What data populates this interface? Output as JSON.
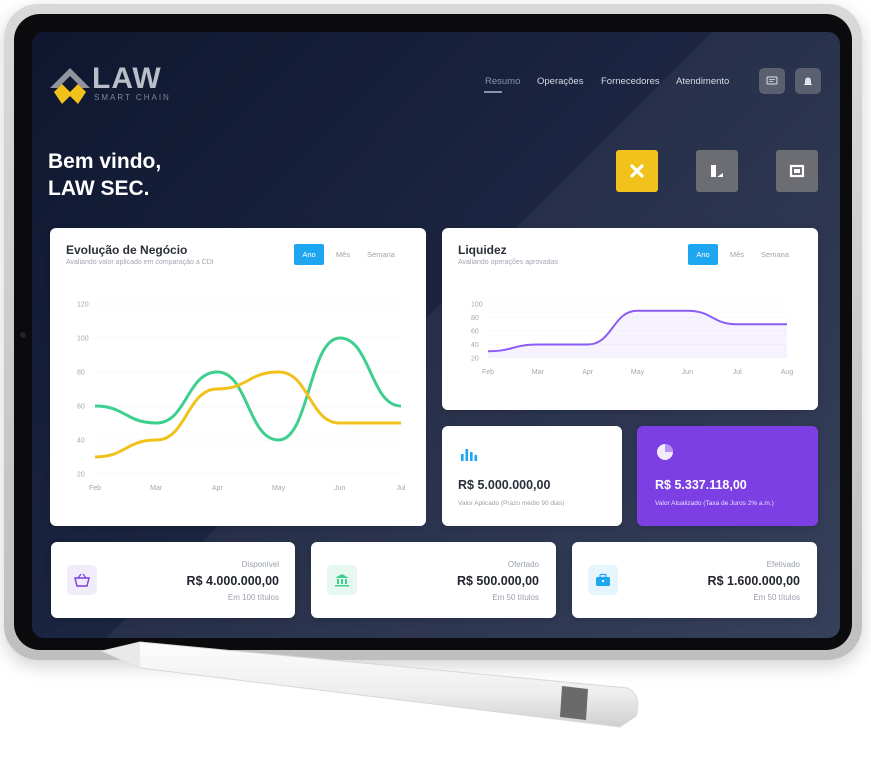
{
  "brand": {
    "name": "LAW",
    "tagline": "SMART CHAIN"
  },
  "nav": {
    "items": [
      {
        "label": "Resumo",
        "active": true
      },
      {
        "label": "Operações",
        "active": false
      },
      {
        "label": "Fornecedores",
        "active": false
      },
      {
        "label": "Atendimento",
        "active": false
      }
    ],
    "icons": [
      "chat-icon",
      "bell-icon"
    ]
  },
  "welcome": {
    "line1": "Bem vindo,",
    "line2": "LAW SEC."
  },
  "quick_actions": [
    {
      "icon": "close-x-icon",
      "color": "#f1c21b"
    },
    {
      "icon": "document-icon",
      "color": "#6b6d72"
    },
    {
      "icon": "building-icon",
      "color": "#6b6d72"
    }
  ],
  "evolucao": {
    "title": "Evolução de Negócio",
    "subtitle": "Avaliando valor aplicado em comparação a CDI",
    "tabs": [
      "Ano",
      "Mês",
      "Semana"
    ],
    "active_tab": "Ano"
  },
  "liquidez": {
    "title": "Liquidez",
    "subtitle": "Avaliando operações aprovadas",
    "tabs": [
      "Ano",
      "Mês",
      "Semana"
    ],
    "active_tab": "Ano"
  },
  "aplicado": {
    "value": "R$ 5.000.000,00",
    "note": "Valor Aplicado (Prazo médio 90 dias)",
    "icon": "bar-chart-icon"
  },
  "atualizado": {
    "value": "R$ 5.337.118,00",
    "note": "Valor Atualizado (Taxa de Juros 2% a.m.)",
    "icon": "pie-chart-icon",
    "color": "#7b3fe4"
  },
  "stats": [
    {
      "label": "Disponível",
      "value": "R$ 4.000.000,00",
      "sub": "Em 100 títulos",
      "icon": "basket-icon",
      "icon_color": "#7b3fe4",
      "icon_bg": "#f1ecfb"
    },
    {
      "label": "Ofertado",
      "value": "R$ 500.000,00",
      "sub": "Em 50 títulos",
      "icon": "bank-icon",
      "icon_color": "#3ecf8e",
      "icon_bg": "#e6f8ef"
    },
    {
      "label": "Efetivado",
      "value": "R$ 1.600.000,00",
      "sub": "Em 50 títulos",
      "icon": "briefcase-icon",
      "icon_color": "#1ea7f0",
      "icon_bg": "#e5f4fd"
    }
  ],
  "chart_data": [
    {
      "type": "line",
      "categories": [
        "Feb",
        "Mar",
        "Apr",
        "May",
        "Jun",
        "Jul"
      ],
      "ylim": [
        20,
        120
      ],
      "yticks": [
        20,
        40,
        60,
        80,
        100,
        120
      ],
      "series": [
        {
          "values": [
            60,
            50,
            80,
            40,
            100,
            60
          ],
          "color": "#3ecf8e"
        },
        {
          "values": [
            30,
            40,
            70,
            80,
            50,
            50
          ],
          "color": "#f1c21b"
        }
      ]
    },
    {
      "type": "area",
      "categories": [
        "Feb",
        "Mar",
        "Apr",
        "May",
        "Jun",
        "Jul",
        "Aug"
      ],
      "ylim": [
        20,
        100
      ],
      "yticks": [
        20,
        40,
        60,
        80,
        100
      ],
      "series": [
        {
          "values": [
            30,
            40,
            40,
            90,
            90,
            70,
            70
          ],
          "color": "#8b5cf6"
        }
      ]
    }
  ]
}
